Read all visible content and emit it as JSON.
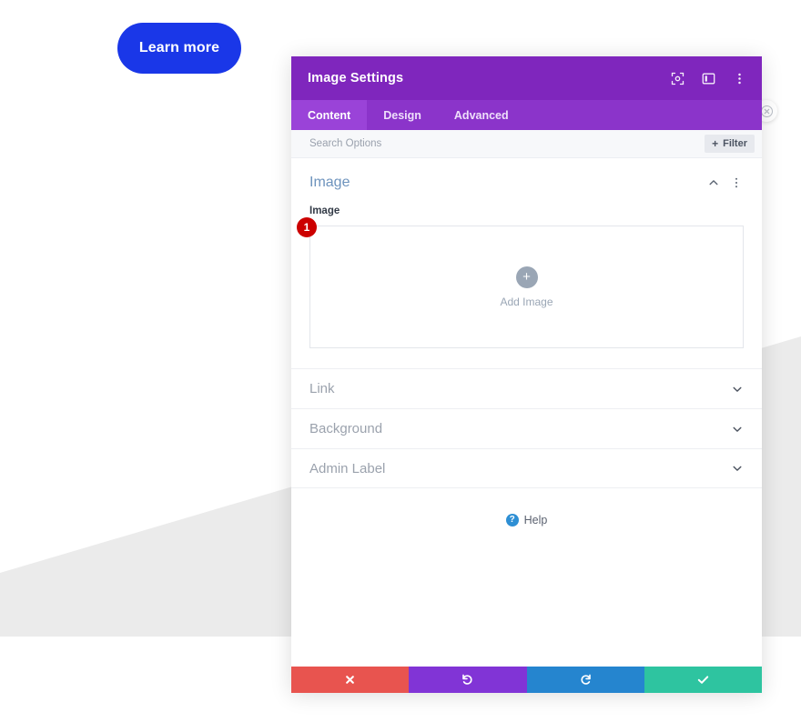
{
  "page": {
    "learn_more_label": "Learn more",
    "learn_more_color": "#1a37e8",
    "background_top_color": "#ffffff",
    "background_bottom_color": "#ebebeb"
  },
  "ghost_close": {
    "icon": "close-circle-icon"
  },
  "modal": {
    "title": "Image Settings",
    "header_color": "#7f26bd",
    "tabs_bar_color": "#8b34ca",
    "active_tab_color": "#9a43d8",
    "title_icons": [
      {
        "name": "focus-target-icon"
      },
      {
        "name": "layout-panel-icon"
      },
      {
        "name": "more-vertical-icon"
      }
    ],
    "tabs": [
      {
        "label": "Content",
        "active": true
      },
      {
        "label": "Design",
        "active": false
      },
      {
        "label": "Advanced",
        "active": false
      }
    ],
    "search": {
      "value": "",
      "placeholder": "Search Options"
    },
    "filter": {
      "label": "Filter",
      "plus": "+"
    },
    "image_section": {
      "title": "Image",
      "collapse_icon": "chevron-up-icon",
      "menu_icon": "more-vertical-icon",
      "field_label": "Image",
      "upload": {
        "plus": "+",
        "label": "Add Image"
      },
      "badge": "1",
      "badge_color": "#cc0000"
    },
    "accordion": [
      {
        "label": "Link",
        "chevron": "chevron-down-icon"
      },
      {
        "label": "Background",
        "chevron": "chevron-down-icon"
      },
      {
        "label": "Admin Label",
        "chevron": "chevron-down-icon"
      }
    ],
    "help": {
      "icon_glyph": "?",
      "label": "Help",
      "icon_color": "#2e8fd4"
    },
    "footer": [
      {
        "name": "close-button",
        "icon": "close-x-icon",
        "color": "#e8544f"
      },
      {
        "name": "undo-button",
        "icon": "undo-icon",
        "color": "#8134d6"
      },
      {
        "name": "redo-button",
        "icon": "redo-icon",
        "color": "#2585cf"
      },
      {
        "name": "save-button",
        "icon": "check-icon",
        "color": "#2ec4a0"
      }
    ]
  }
}
